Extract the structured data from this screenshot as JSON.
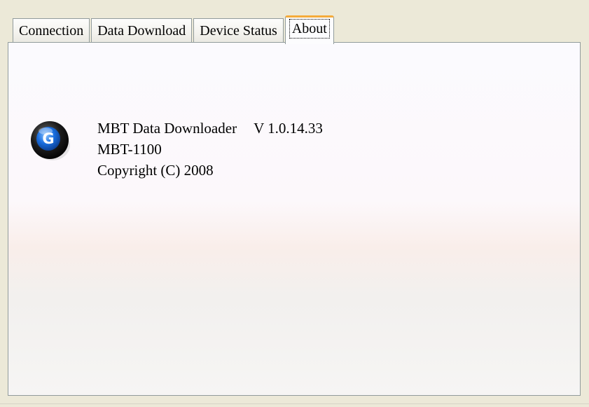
{
  "tabs": [
    {
      "label": "Connection",
      "selected": false
    },
    {
      "label": "Data Download",
      "selected": false
    },
    {
      "label": "Device Status",
      "selected": false
    },
    {
      "label": "About",
      "selected": true
    }
  ],
  "about": {
    "product_name": "MBT Data Downloader",
    "version": "V 1.0.14.33",
    "model": "MBT-1100",
    "copyright": "Copyright (C) 2008",
    "logo_letter": "G",
    "logo_icon": "app-logo-icon"
  },
  "colors": {
    "window_background": "#ece9d8",
    "active_tab_highlight": "#f5ab3a",
    "border": "#919b9c",
    "logo_blue": "#1a6fe0"
  }
}
